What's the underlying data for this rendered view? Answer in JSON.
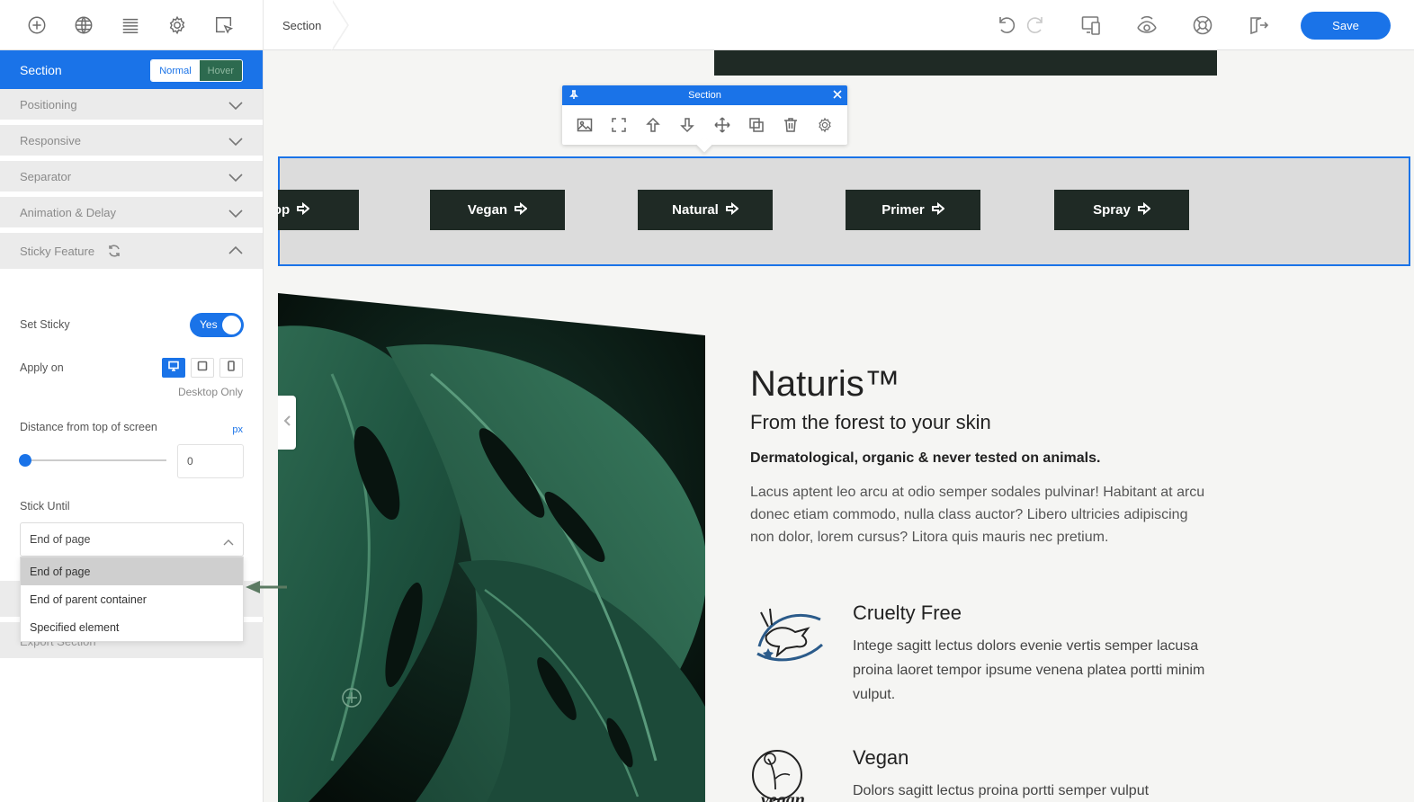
{
  "topbar": {
    "breadcrumb": "Section",
    "save_label": "Save",
    "left_icons": [
      "add-icon",
      "globe-icon",
      "layers-icon",
      "settings-icon",
      "select-cursor-icon"
    ],
    "right_icons": [
      "undo-icon",
      "redo-icon",
      "responsive-preview-icon",
      "eye-icon",
      "help-icon",
      "exit-icon"
    ]
  },
  "panel": {
    "title": "Section",
    "state_normal": "Normal",
    "state_hover": "Hover",
    "accordions": [
      "Positioning",
      "Responsive",
      "Separator",
      "Animation & Delay"
    ],
    "sticky_title": "Sticky Feature",
    "set_sticky_label": "Set Sticky",
    "set_sticky_value": "Yes",
    "apply_on_label": "Apply on",
    "apply_on_note": "Desktop Only",
    "distance_label": "Distance from top of screen",
    "distance_unit": "px",
    "distance_value": "0",
    "stick_until_label": "Stick Until",
    "stick_until_value": "End of page",
    "stick_until_options": [
      "End of page",
      "End of parent container",
      "Specified element"
    ],
    "behind_label": "Export Section"
  },
  "canvas": {
    "toolbar_title": "Section",
    "categories": [
      "op",
      "Vegan",
      "Natural",
      "Primer",
      "Spray"
    ],
    "brand": "Naturis™",
    "tagline": "From the forest to your skin",
    "bold_line": "Dermatological, organic & never tested on animals.",
    "paragraph": "Lacus aptent leo arcu at odio semper sodales pulvinar! Habitant at arcu donec etiam commodo, nulla class auctor? Libero ultricies adipiscing non dolor, lorem cursus? Litora quis mauris nec pretium.",
    "features": [
      {
        "title": "Cruelty Free",
        "text": "Intege sagitt lectus dolors evenie vertis semper lacusa proina laoret tempor ipsume venena platea portti minim vulput."
      },
      {
        "title": "Vegan",
        "text": "Dolors sagitt lectus proina portti semper vulput"
      }
    ],
    "vegan_logo_text": "vegan"
  },
  "colors": {
    "accent": "#1a73e8",
    "dark_button": "#1f2a25",
    "hover_seg": "#2d6a4f"
  }
}
